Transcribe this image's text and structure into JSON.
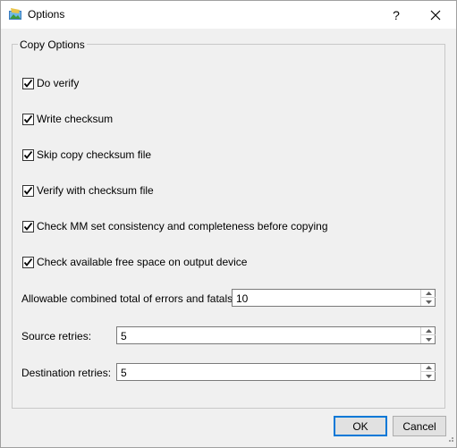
{
  "window": {
    "title": "Options",
    "help_label": "?",
    "icon": "app-options-icon"
  },
  "group": {
    "title": "Copy Options",
    "checkboxes": [
      {
        "label": "Do verify",
        "checked": true
      },
      {
        "label": "Write checksum",
        "checked": true
      },
      {
        "label": "Skip copy checksum file",
        "checked": true
      },
      {
        "label": "Verify with checksum file",
        "checked": true
      },
      {
        "label": "Check MM set consistency and completeness before copying",
        "checked": true
      },
      {
        "label": "Check available free space on output device",
        "checked": true
      }
    ],
    "fields": [
      {
        "label": "Allowable combined total of errors and fatals:",
        "value": "10"
      },
      {
        "label": "Source retries:",
        "value": "5"
      },
      {
        "label": "Destination retries:",
        "value": "5"
      }
    ]
  },
  "buttons": {
    "ok": "OK",
    "cancel": "Cancel"
  },
  "colors": {
    "accent": "#0078d7",
    "background": "#f0f0f0"
  }
}
